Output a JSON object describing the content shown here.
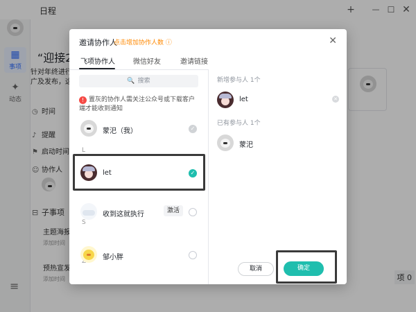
{
  "window": {
    "title": "日程",
    "add_icon": "+",
    "min_icon": "—",
    "max_icon": "☐",
    "close_icon": "✕"
  },
  "rail": {
    "active_label": "事项",
    "second_label": "动态"
  },
  "task": {
    "title": "“迎接202",
    "desc_line1": "针对年终进行",
    "desc_line2": "广及发布，这",
    "time_label": "时间",
    "reminder_label": "提醒",
    "start_label": "启动时间",
    "collab_label": "协作人",
    "subtask_label": "子事项",
    "subtasks": [
      {
        "title": "主题海报",
        "meta": "添加时间"
      },
      {
        "title": "预热宣发",
        "meta": "添加时间"
      }
    ],
    "bottom_badge": "项 0"
  },
  "dialog": {
    "title": "邀请协作人",
    "link": "点击增加协作人数",
    "tabs": [
      {
        "label": "飞项协作人",
        "active": true
      },
      {
        "label": "微信好友",
        "active": false
      },
      {
        "label": "邀请链接",
        "active": false
      }
    ],
    "search_placeholder": "搜索",
    "notice": "置灰的协作人需关注公众号或下载客户端才能收到通知",
    "letters": [
      "L",
      "S",
      "Z"
    ],
    "contacts": [
      {
        "name": "蒙汜（我）",
        "state": "done",
        "avatar": "dog"
      },
      {
        "name": "let",
        "state": "on",
        "avatar": "girl"
      },
      {
        "name": "收到这就执行",
        "state": "off",
        "avatar": "cloud",
        "action": "激活"
      },
      {
        "name": "邹小胖",
        "state": "off",
        "avatar": "chick"
      }
    ],
    "new_section": "新增参与人 1个",
    "existing_section": "已有参与人 1个",
    "new_members": [
      {
        "name": "let",
        "avatar": "girl"
      }
    ],
    "existing_members": [
      {
        "name": "蒙汜",
        "avatar": "dog"
      }
    ],
    "cancel_label": "取消",
    "confirm_label": "确定",
    "accent": "#1fbeae",
    "link_color": "#ff8800"
  }
}
